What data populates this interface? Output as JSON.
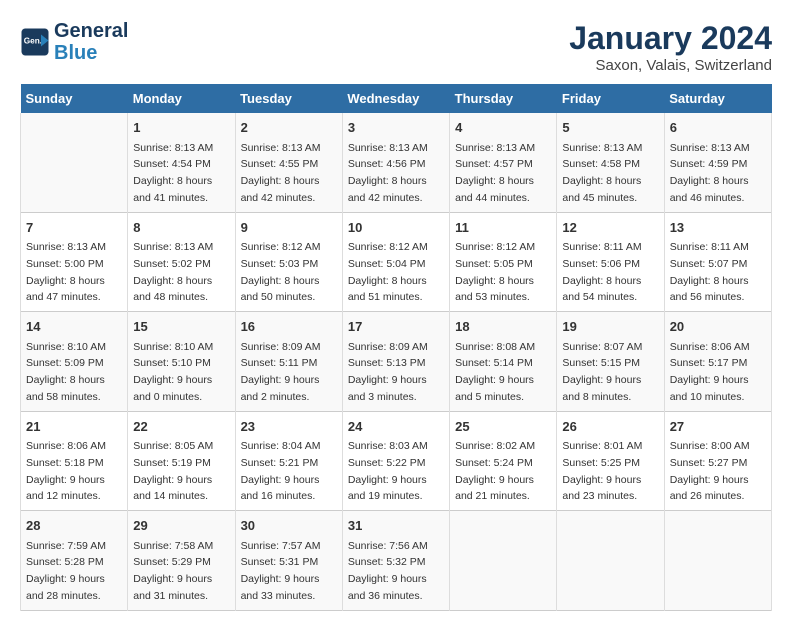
{
  "header": {
    "logo_line1": "General",
    "logo_line2": "Blue",
    "month": "January 2024",
    "location": "Saxon, Valais, Switzerland"
  },
  "weekdays": [
    "Sunday",
    "Monday",
    "Tuesday",
    "Wednesday",
    "Thursday",
    "Friday",
    "Saturday"
  ],
  "weeks": [
    [
      {
        "day": "",
        "info": ""
      },
      {
        "day": "1",
        "info": "Sunrise: 8:13 AM\nSunset: 4:54 PM\nDaylight: 8 hours\nand 41 minutes."
      },
      {
        "day": "2",
        "info": "Sunrise: 8:13 AM\nSunset: 4:55 PM\nDaylight: 8 hours\nand 42 minutes."
      },
      {
        "day": "3",
        "info": "Sunrise: 8:13 AM\nSunset: 4:56 PM\nDaylight: 8 hours\nand 42 minutes."
      },
      {
        "day": "4",
        "info": "Sunrise: 8:13 AM\nSunset: 4:57 PM\nDaylight: 8 hours\nand 44 minutes."
      },
      {
        "day": "5",
        "info": "Sunrise: 8:13 AM\nSunset: 4:58 PM\nDaylight: 8 hours\nand 45 minutes."
      },
      {
        "day": "6",
        "info": "Sunrise: 8:13 AM\nSunset: 4:59 PM\nDaylight: 8 hours\nand 46 minutes."
      }
    ],
    [
      {
        "day": "7",
        "info": "Sunrise: 8:13 AM\nSunset: 5:00 PM\nDaylight: 8 hours\nand 47 minutes."
      },
      {
        "day": "8",
        "info": "Sunrise: 8:13 AM\nSunset: 5:02 PM\nDaylight: 8 hours\nand 48 minutes."
      },
      {
        "day": "9",
        "info": "Sunrise: 8:12 AM\nSunset: 5:03 PM\nDaylight: 8 hours\nand 50 minutes."
      },
      {
        "day": "10",
        "info": "Sunrise: 8:12 AM\nSunset: 5:04 PM\nDaylight: 8 hours\nand 51 minutes."
      },
      {
        "day": "11",
        "info": "Sunrise: 8:12 AM\nSunset: 5:05 PM\nDaylight: 8 hours\nand 53 minutes."
      },
      {
        "day": "12",
        "info": "Sunrise: 8:11 AM\nSunset: 5:06 PM\nDaylight: 8 hours\nand 54 minutes."
      },
      {
        "day": "13",
        "info": "Sunrise: 8:11 AM\nSunset: 5:07 PM\nDaylight: 8 hours\nand 56 minutes."
      }
    ],
    [
      {
        "day": "14",
        "info": "Sunrise: 8:10 AM\nSunset: 5:09 PM\nDaylight: 8 hours\nand 58 minutes."
      },
      {
        "day": "15",
        "info": "Sunrise: 8:10 AM\nSunset: 5:10 PM\nDaylight: 9 hours\nand 0 minutes."
      },
      {
        "day": "16",
        "info": "Sunrise: 8:09 AM\nSunset: 5:11 PM\nDaylight: 9 hours\nand 2 minutes."
      },
      {
        "day": "17",
        "info": "Sunrise: 8:09 AM\nSunset: 5:13 PM\nDaylight: 9 hours\nand 3 minutes."
      },
      {
        "day": "18",
        "info": "Sunrise: 8:08 AM\nSunset: 5:14 PM\nDaylight: 9 hours\nand 5 minutes."
      },
      {
        "day": "19",
        "info": "Sunrise: 8:07 AM\nSunset: 5:15 PM\nDaylight: 9 hours\nand 8 minutes."
      },
      {
        "day": "20",
        "info": "Sunrise: 8:06 AM\nSunset: 5:17 PM\nDaylight: 9 hours\nand 10 minutes."
      }
    ],
    [
      {
        "day": "21",
        "info": "Sunrise: 8:06 AM\nSunset: 5:18 PM\nDaylight: 9 hours\nand 12 minutes."
      },
      {
        "day": "22",
        "info": "Sunrise: 8:05 AM\nSunset: 5:19 PM\nDaylight: 9 hours\nand 14 minutes."
      },
      {
        "day": "23",
        "info": "Sunrise: 8:04 AM\nSunset: 5:21 PM\nDaylight: 9 hours\nand 16 minutes."
      },
      {
        "day": "24",
        "info": "Sunrise: 8:03 AM\nSunset: 5:22 PM\nDaylight: 9 hours\nand 19 minutes."
      },
      {
        "day": "25",
        "info": "Sunrise: 8:02 AM\nSunset: 5:24 PM\nDaylight: 9 hours\nand 21 minutes."
      },
      {
        "day": "26",
        "info": "Sunrise: 8:01 AM\nSunset: 5:25 PM\nDaylight: 9 hours\nand 23 minutes."
      },
      {
        "day": "27",
        "info": "Sunrise: 8:00 AM\nSunset: 5:27 PM\nDaylight: 9 hours\nand 26 minutes."
      }
    ],
    [
      {
        "day": "28",
        "info": "Sunrise: 7:59 AM\nSunset: 5:28 PM\nDaylight: 9 hours\nand 28 minutes."
      },
      {
        "day": "29",
        "info": "Sunrise: 7:58 AM\nSunset: 5:29 PM\nDaylight: 9 hours\nand 31 minutes."
      },
      {
        "day": "30",
        "info": "Sunrise: 7:57 AM\nSunset: 5:31 PM\nDaylight: 9 hours\nand 33 minutes."
      },
      {
        "day": "31",
        "info": "Sunrise: 7:56 AM\nSunset: 5:32 PM\nDaylight: 9 hours\nand 36 minutes."
      },
      {
        "day": "",
        "info": ""
      },
      {
        "day": "",
        "info": ""
      },
      {
        "day": "",
        "info": ""
      }
    ]
  ]
}
